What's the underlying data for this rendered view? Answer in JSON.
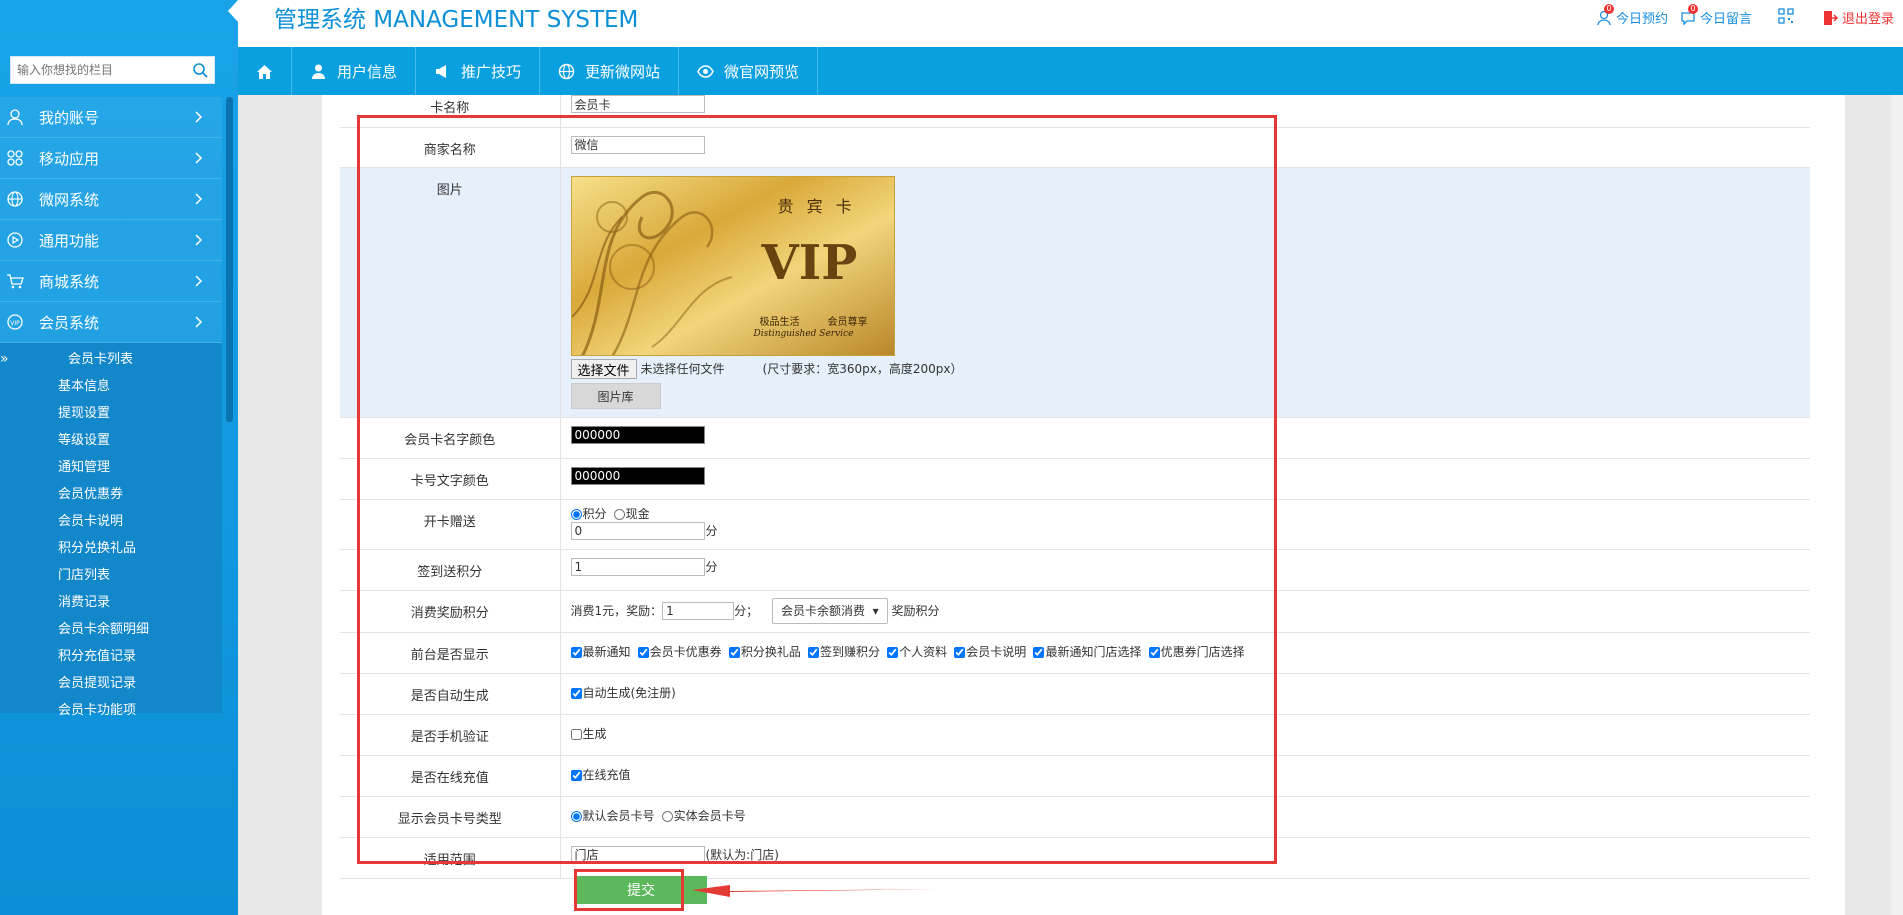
{
  "header": {
    "brand": "管理系统 MANAGEMENT SYSTEM",
    "links": [
      {
        "label": "今日预约",
        "badge": "0"
      },
      {
        "label": "今日留言",
        "badge": "0"
      }
    ],
    "logout": "退出登录"
  },
  "sidebar": {
    "search_placeholder": "输入你想找的栏目",
    "items": [
      {
        "label": "我的账号",
        "icon": "user-icon"
      },
      {
        "label": "移动应用",
        "icon": "apps-icon"
      },
      {
        "label": "微网系统",
        "icon": "globe-icon"
      },
      {
        "label": "通用功能",
        "icon": "play-icon"
      },
      {
        "label": "商城系统",
        "icon": "cart-icon"
      },
      {
        "label": "会员系统",
        "icon": "vip-icon"
      }
    ],
    "subitems": [
      "会员卡列表",
      "基本信息",
      "提现设置",
      "等级设置",
      "通知管理",
      "会员优惠券",
      "会员卡说明",
      "积分兑换礼品",
      "门店列表",
      "消费记录",
      "会员卡余额明细",
      "积分充值记录",
      "会员提现记录",
      "会员卡功能项"
    ],
    "active_sub": "»"
  },
  "navbar": {
    "items": [
      "用户信息",
      "推广技巧",
      "更新微网站",
      "微官网预览"
    ]
  },
  "form": {
    "card_name_label": "卡名称",
    "card_name_value": "会员卡",
    "merchant_label": "商家名称",
    "merchant_value": "微信",
    "image_label": "图片",
    "card_title": "贵 宾 卡",
    "card_vip": "VIP",
    "card_sub1": "极品生活",
    "card_sub2": "会员尊享",
    "card_sub3": "Distinguished Service",
    "file_button": "选择文件",
    "file_status": "未选择任何文件",
    "size_hint": "(尺寸要求：宽360px，高度200px）",
    "lib_button": "图片库",
    "name_color_label": "会员卡名字颜色",
    "name_color_value": "000000",
    "num_color_label": "卡号文字颜色",
    "num_color_value": "000000",
    "open_gift_label": "开卡赠送",
    "open_gift_opt1": "积分",
    "open_gift_opt2": "现金",
    "open_gift_value": "0",
    "unit_fen": "分",
    "signin_label": "签到送积分",
    "signin_value": "1",
    "consume_label": "消费奖励积分",
    "consume_prefix": "消费1元，奖励：",
    "consume_value": "1",
    "consume_mid": "分；",
    "consume_select": "会员卡余额消费",
    "consume_suffix": "奖励积分",
    "front_label": "前台是否显示",
    "front_opts": [
      "最新通知",
      "会员卡优惠券",
      "积分换礼品",
      "签到赚积分",
      "个人资料",
      "会员卡说明",
      "最新通知门店选择",
      "优惠券门店选择"
    ],
    "auto_label": "是否自动生成",
    "auto_opt": "自动生成(免注册)",
    "phone_label": "是否手机验证",
    "phone_opt": "生成",
    "online_label": "是否在线充值",
    "online_opt": "在线充值",
    "type_label": "显示会员卡号类型",
    "type_opt1": "默认会员卡号",
    "type_opt2": "实体会员卡号",
    "scope_label": "适用范围",
    "scope_value": "门店",
    "scope_hint": "(默认为:门店)",
    "submit": "提交"
  },
  "colors": {
    "accent": "#0aa0e0",
    "submit": "#5cb85c",
    "annotation": "#e53935"
  }
}
